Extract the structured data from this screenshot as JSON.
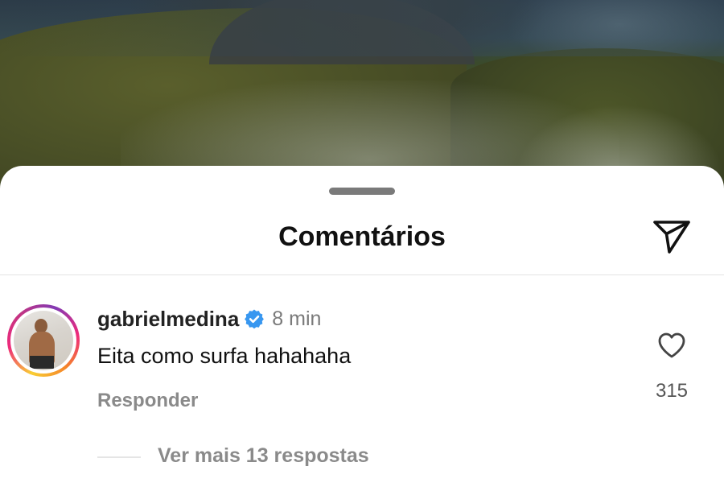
{
  "sheet": {
    "title": "Comentários",
    "share_icon": "paper-plane-icon"
  },
  "comment": {
    "username": "gabrielmedina",
    "verified": true,
    "verified_icon": "verified-badge-icon",
    "verified_color": "#3897f0",
    "time": "8 min",
    "text": "Eita como surfa hahahaha",
    "reply_label": "Responder",
    "like_icon": "heart-outline-icon",
    "like_count": "315",
    "view_replies_label": "Ver mais 13 respostas"
  },
  "colors": {
    "sheet_background": "#ffffff",
    "primary_text": "#111111",
    "secondary_text": "#8a8a8a",
    "story_ring": [
      "#f9ce34",
      "#ee2a7b",
      "#833ab4"
    ]
  }
}
